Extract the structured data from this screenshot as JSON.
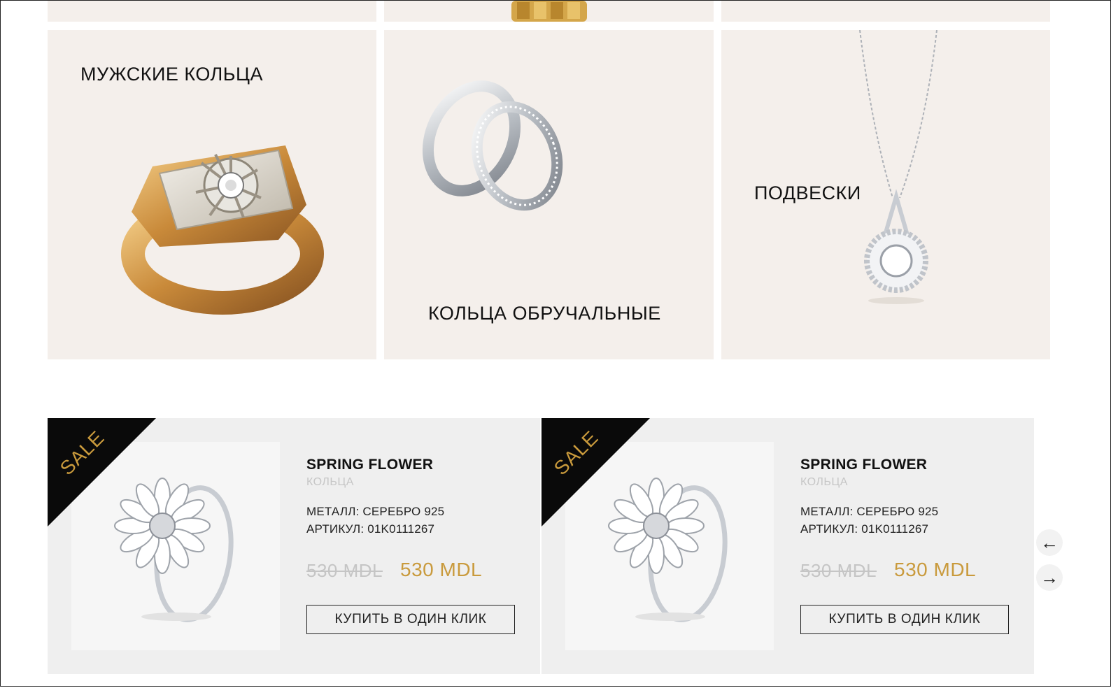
{
  "categories": [
    {
      "title": "МУЖСКИЕ КОЛЬЦА",
      "image": "mens-signet-ring"
    },
    {
      "title": "КОЛЬЦА ОБРУЧАЛЬНЫЕ",
      "image": "wedding-rings-pair"
    },
    {
      "title": "ПОДВЕСКИ",
      "image": "diamond-pendant-necklace"
    }
  ],
  "products": [
    {
      "badge": "SALE",
      "name": "SPRING FLOWER",
      "category": "КОЛЬЦА",
      "metal": "МЕТАЛЛ: СЕРЕБРО 925",
      "sku": "АРТИКУЛ: 01K0111267",
      "old_price": "530 MDL",
      "price": "530 MDL",
      "buy_label": "КУПИТЬ В ОДИН КЛИК",
      "image": "daisy-silver-ring"
    },
    {
      "badge": "SALE",
      "name": "SPRING FLOWER",
      "category": "КОЛЬЦА",
      "metal": "МЕТАЛЛ: СЕРЕБРО 925",
      "sku": "АРТИКУЛ: 01K0111267",
      "old_price": "530 MDL",
      "price": "530 MDL",
      "buy_label": "КУПИТЬ В ОДИН КЛИК",
      "image": "daisy-silver-ring"
    }
  ],
  "carousel": {
    "prev_icon": "arrow-left-icon",
    "next_icon": "arrow-right-icon",
    "prev_glyph": "←",
    "next_glyph": "→"
  },
  "colors": {
    "tile_bg": "#f4efeb",
    "card_bg": "#efefef",
    "accent_gold": "#c99a3c",
    "sale_bg": "#0a0a0a"
  }
}
